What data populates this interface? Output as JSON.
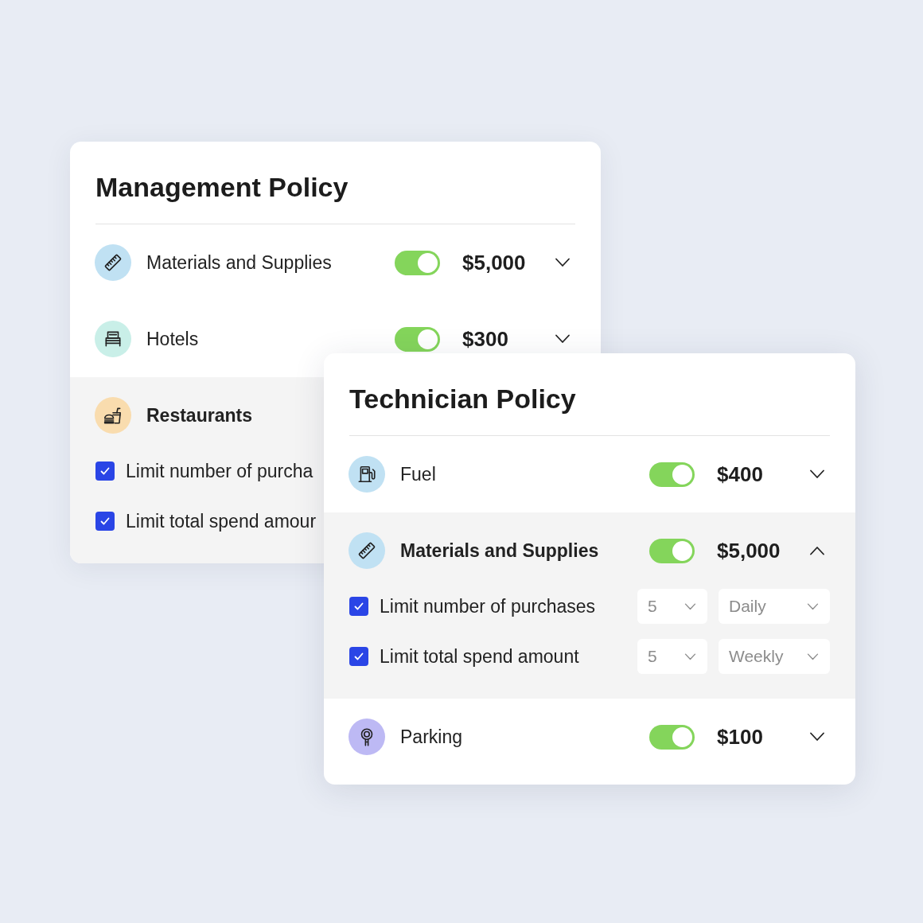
{
  "policies": [
    {
      "title": "Management Policy",
      "categories": [
        {
          "kind": "materials",
          "color": "#c0e1f3",
          "label": "Materials and Supplies",
          "on": true,
          "amount": "$5,000",
          "expanded": false
        },
        {
          "kind": "lodging",
          "color": "#c9efe8",
          "label": "Hotels",
          "on": true,
          "amount": "$300",
          "expanded": false
        },
        {
          "kind": "dining",
          "color": "#f9dcae",
          "label": "Restaurants",
          "expanded": true,
          "limits": [
            {
              "label": "Limit number of purcha",
              "checked": true
            },
            {
              "label": "Limit total spend amour",
              "checked": true
            }
          ]
        }
      ]
    },
    {
      "title": "Technician Policy",
      "categories": [
        {
          "kind": "fuel",
          "color": "#c0e1f3",
          "label": "Fuel",
          "on": true,
          "amount": "$400",
          "expanded": false
        },
        {
          "kind": "materials",
          "color": "#c0e1f3",
          "label": "Materials and Supplies",
          "on": true,
          "amount": "$5,000",
          "expanded": true,
          "limits": [
            {
              "label": "Limit number of purchases",
              "checked": true,
              "count": "5",
              "period": "Daily"
            },
            {
              "label": "Limit total spend amount",
              "checked": true,
              "count": "5",
              "period": "Weekly"
            }
          ]
        },
        {
          "kind": "parking",
          "color": "#bdb9f4",
          "label": "Parking",
          "on": true,
          "amount": "$100",
          "expanded": false
        }
      ]
    }
  ]
}
